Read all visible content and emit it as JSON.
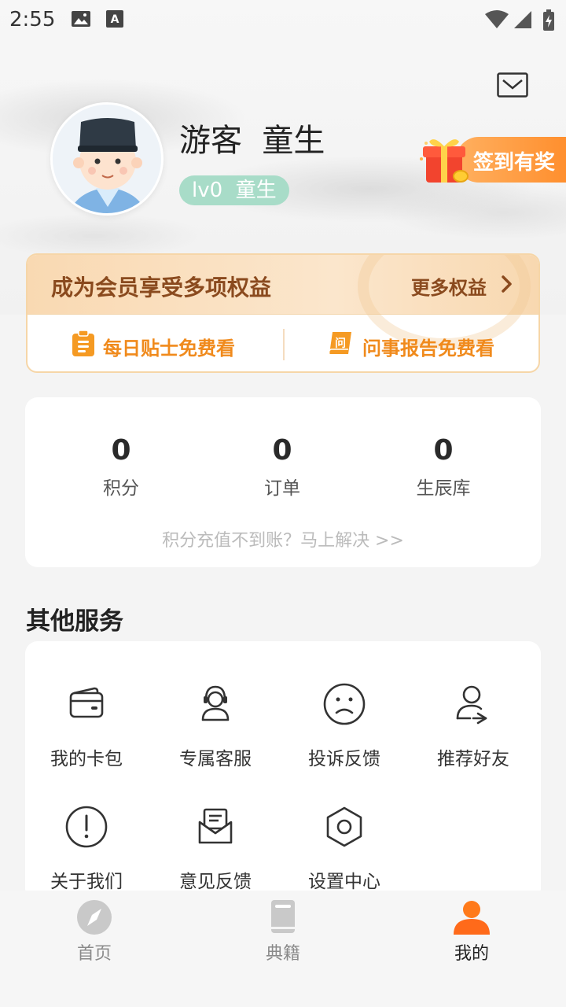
{
  "status_bar": {
    "time": "2:55",
    "icons": [
      "image-icon",
      "font-download-icon",
      "wifi-icon",
      "signal-icon",
      "battery-charging-icon"
    ]
  },
  "header": {
    "mail_icon": "mail-icon",
    "avatar_icon": "scholar-avatar",
    "user_name": "游客  童生",
    "level_badge": "lv0  童生",
    "checkin_label": "签到有奖",
    "checkin_icon": "gift-icon"
  },
  "member": {
    "title": "成为会员享受多项权益",
    "more": "更多权益",
    "perks": [
      {
        "label": "每日贴士免费看",
        "icon": "clipboard-icon"
      },
      {
        "label": "问事报告免费看",
        "icon": "scroll-icon"
      }
    ],
    "colors": {
      "accent": "#f08a1c",
      "title": "#8a4a1e"
    }
  },
  "stats": {
    "items": [
      {
        "value": "0",
        "label": "积分"
      },
      {
        "value": "0",
        "label": "订单"
      },
      {
        "value": "0",
        "label": "生辰库"
      }
    ],
    "hint": "积分充值不到账？马上解决 >>"
  },
  "services": {
    "title": "其他服务",
    "items": [
      {
        "label": "我的卡包",
        "icon": "wallet-icon"
      },
      {
        "label": "专属客服",
        "icon": "headset-user-icon"
      },
      {
        "label": "投诉反馈",
        "icon": "sad-face-icon"
      },
      {
        "label": "推荐好友",
        "icon": "share-user-icon"
      },
      {
        "label": "关于我们",
        "icon": "info-alert-icon"
      },
      {
        "label": "意见反馈",
        "icon": "mail-open-icon"
      },
      {
        "label": "设置中心",
        "icon": "settings-hex-icon"
      }
    ]
  },
  "bottom_nav": {
    "items": [
      {
        "label": "首页",
        "icon": "compass-icon",
        "active": false
      },
      {
        "label": "典籍",
        "icon": "book-icon",
        "active": false
      },
      {
        "label": "我的",
        "icon": "user-icon",
        "active": true
      }
    ],
    "active_color": "#ff6a1a"
  }
}
